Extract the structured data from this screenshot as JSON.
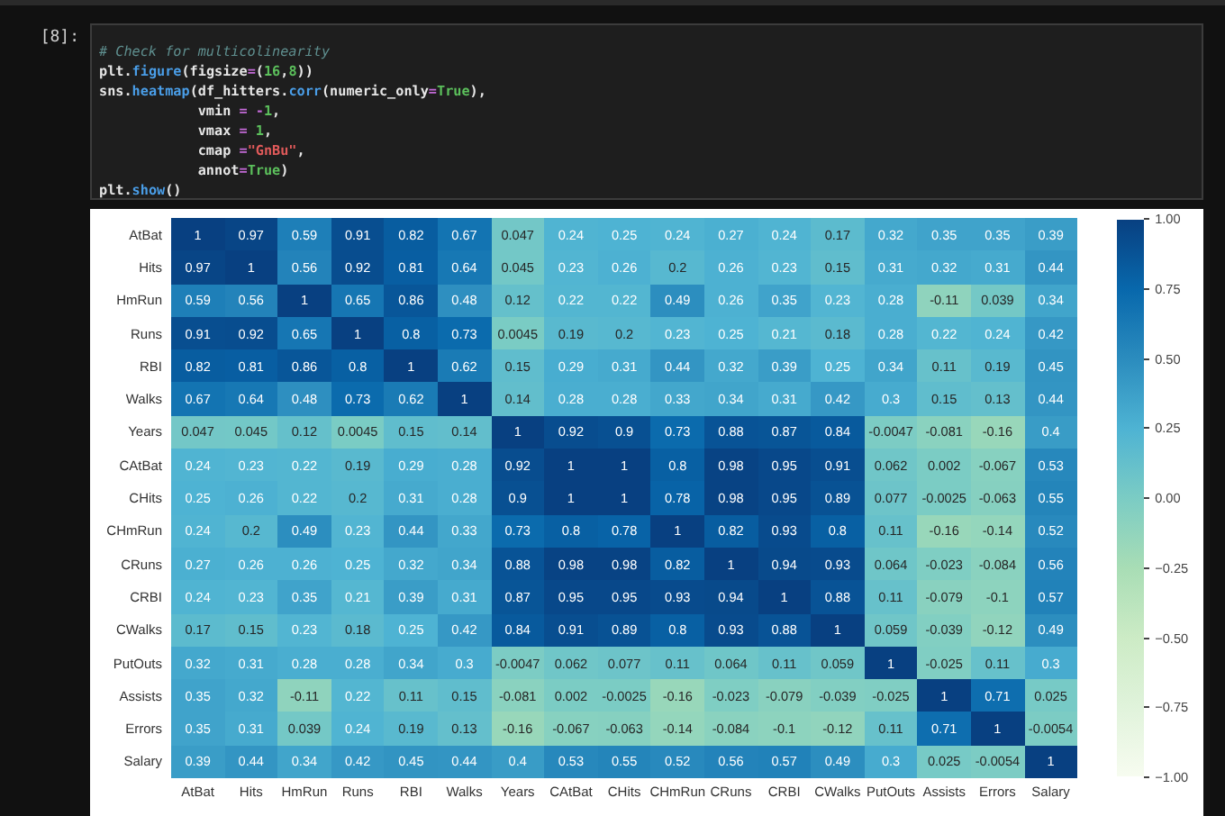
{
  "cell": {
    "prompt": "[8]:",
    "code_lines": [
      [
        {
          "kind": "comment",
          "text": "# Check for multicolinearity"
        }
      ],
      [
        {
          "kind": "plain",
          "text": "plt."
        },
        {
          "kind": "func",
          "text": "figure"
        },
        {
          "kind": "plain",
          "text": "(figsize"
        },
        {
          "kind": "op",
          "text": "="
        },
        {
          "kind": "plain",
          "text": "("
        },
        {
          "kind": "number",
          "text": "16"
        },
        {
          "kind": "plain",
          "text": ","
        },
        {
          "kind": "number",
          "text": "8"
        },
        {
          "kind": "plain",
          "text": "))"
        }
      ],
      [
        {
          "kind": "plain",
          "text": "sns."
        },
        {
          "kind": "func",
          "text": "heatmap"
        },
        {
          "kind": "plain",
          "text": "(df_hitters."
        },
        {
          "kind": "func",
          "text": "corr"
        },
        {
          "kind": "plain",
          "text": "(numeric_only"
        },
        {
          "kind": "op",
          "text": "="
        },
        {
          "kind": "keyword",
          "text": "True"
        },
        {
          "kind": "plain",
          "text": "),"
        }
      ],
      [
        {
          "kind": "plain",
          "text": "            vmin "
        },
        {
          "kind": "op",
          "text": "= -"
        },
        {
          "kind": "number",
          "text": "1"
        },
        {
          "kind": "plain",
          "text": ","
        }
      ],
      [
        {
          "kind": "plain",
          "text": "            vmax "
        },
        {
          "kind": "op",
          "text": "="
        },
        {
          "kind": "number",
          "text": " 1"
        },
        {
          "kind": "plain",
          "text": ","
        }
      ],
      [
        {
          "kind": "plain",
          "text": "            cmap "
        },
        {
          "kind": "op",
          "text": "="
        },
        {
          "kind": "string",
          "text": "\"GnBu\""
        },
        {
          "kind": "plain",
          "text": ","
        }
      ],
      [
        {
          "kind": "plain",
          "text": "            annot"
        },
        {
          "kind": "op",
          "text": "="
        },
        {
          "kind": "keyword",
          "text": "True"
        },
        {
          "kind": "plain",
          "text": ")"
        }
      ],
      [
        {
          "kind": "plain",
          "text": "plt."
        },
        {
          "kind": "func",
          "text": "show"
        },
        {
          "kind": "plain",
          "text": "()"
        }
      ]
    ]
  },
  "heatmap": {
    "column_labels": [
      "AtBat",
      "Hits",
      "HmRun",
      "Runs",
      "RBI",
      "Walks",
      "Years",
      "CAtBat",
      "CHits",
      "CHmRun",
      "CRuns",
      "CRBI",
      "CWalks",
      "PutOuts",
      "Assists",
      "Errors",
      "Salary"
    ],
    "rows": [
      {
        "label": "AtBat",
        "cells": [
          "1",
          "0.97",
          "0.59",
          "0.91",
          "0.82",
          "0.67",
          "0.047",
          "0.24",
          "0.25",
          "0.24",
          "0.27",
          "0.24",
          "0.17",
          "0.32",
          "0.35",
          "0.35",
          "0.39"
        ]
      },
      {
        "label": "Hits",
        "cells": [
          "0.97",
          "1",
          "0.56",
          "0.92",
          "0.81",
          "0.64",
          "0.045",
          "0.23",
          "0.26",
          "0.2",
          "0.26",
          "0.23",
          "0.15",
          "0.31",
          "0.32",
          "0.31",
          "0.44"
        ]
      },
      {
        "label": "HmRun",
        "cells": [
          "0.59",
          "0.56",
          "1",
          "0.65",
          "0.86",
          "0.48",
          "0.12",
          "0.22",
          "0.22",
          "0.49",
          "0.26",
          "0.35",
          "0.23",
          "0.28",
          "-0.11",
          "0.039",
          "0.34"
        ]
      },
      {
        "label": "Runs",
        "cells": [
          "0.91",
          "0.92",
          "0.65",
          "1",
          "0.8",
          "0.73",
          "0.0045",
          "0.19",
          "0.2",
          "0.23",
          "0.25",
          "0.21",
          "0.18",
          "0.28",
          "0.22",
          "0.24",
          "0.42"
        ]
      },
      {
        "label": "RBI",
        "cells": [
          "0.82",
          "0.81",
          "0.86",
          "0.8",
          "1",
          "0.62",
          "0.15",
          "0.29",
          "0.31",
          "0.44",
          "0.32",
          "0.39",
          "0.25",
          "0.34",
          "0.11",
          "0.19",
          "0.45"
        ]
      },
      {
        "label": "Walks",
        "cells": [
          "0.67",
          "0.64",
          "0.48",
          "0.73",
          "0.62",
          "1",
          "0.14",
          "0.28",
          "0.28",
          "0.33",
          "0.34",
          "0.31",
          "0.42",
          "0.3",
          "0.15",
          "0.13",
          "0.44"
        ]
      },
      {
        "label": "Years",
        "cells": [
          "0.047",
          "0.045",
          "0.12",
          "0.0045",
          "0.15",
          "0.14",
          "1",
          "0.92",
          "0.9",
          "0.73",
          "0.88",
          "0.87",
          "0.84",
          "-0.0047",
          "-0.081",
          "-0.16",
          "0.4"
        ]
      },
      {
        "label": "CAtBat",
        "cells": [
          "0.24",
          "0.23",
          "0.22",
          "0.19",
          "0.29",
          "0.28",
          "0.92",
          "1",
          "1",
          "0.8",
          "0.98",
          "0.95",
          "0.91",
          "0.062",
          "0.002",
          "-0.067",
          "0.53"
        ]
      },
      {
        "label": "CHits",
        "cells": [
          "0.25",
          "0.26",
          "0.22",
          "0.2",
          "0.31",
          "0.28",
          "0.9",
          "1",
          "1",
          "0.78",
          "0.98",
          "0.95",
          "0.89",
          "0.077",
          "-0.0025",
          "-0.063",
          "0.55"
        ]
      },
      {
        "label": "CHmRun",
        "cells": [
          "0.24",
          "0.2",
          "0.49",
          "0.23",
          "0.44",
          "0.33",
          "0.73",
          "0.8",
          "0.78",
          "1",
          "0.82",
          "0.93",
          "0.8",
          "0.11",
          "-0.16",
          "-0.14",
          "0.52"
        ]
      },
      {
        "label": "CRuns",
        "cells": [
          "0.27",
          "0.26",
          "0.26",
          "0.25",
          "0.32",
          "0.34",
          "0.88",
          "0.98",
          "0.98",
          "0.82",
          "1",
          "0.94",
          "0.93",
          "0.064",
          "-0.023",
          "-0.084",
          "0.56"
        ]
      },
      {
        "label": "CRBI",
        "cells": [
          "0.24",
          "0.23",
          "0.35",
          "0.21",
          "0.39",
          "0.31",
          "0.87",
          "0.95",
          "0.95",
          "0.93",
          "0.94",
          "1",
          "0.88",
          "0.11",
          "-0.079",
          "-0.1",
          "0.57"
        ]
      },
      {
        "label": "CWalks",
        "cells": [
          "0.17",
          "0.15",
          "0.23",
          "0.18",
          "0.25",
          "0.42",
          "0.84",
          "0.91",
          "0.89",
          "0.8",
          "0.93",
          "0.88",
          "1",
          "0.059",
          "-0.039",
          "-0.12",
          "0.49"
        ]
      },
      {
        "label": "PutOuts",
        "cells": [
          "0.32",
          "0.31",
          "0.28",
          "0.28",
          "0.34",
          "0.3",
          "-0.0047",
          "0.062",
          "0.077",
          "0.11",
          "0.064",
          "0.11",
          "0.059",
          "1",
          "-0.025",
          "0.11",
          "0.3"
        ]
      },
      {
        "label": "Assists",
        "cells": [
          "0.35",
          "0.32",
          "-0.11",
          "0.22",
          "0.11",
          "0.15",
          "-0.081",
          "0.002",
          "-0.0025",
          "-0.16",
          "-0.023",
          "-0.079",
          "-0.039",
          "-0.025",
          "1",
          "0.71",
          "0.025"
        ]
      },
      {
        "label": "Errors",
        "cells": [
          "0.35",
          "0.31",
          "0.039",
          "0.24",
          "0.19",
          "0.13",
          "-0.16",
          "-0.067",
          "-0.063",
          "-0.14",
          "-0.084",
          "-0.1",
          "-0.12",
          "0.11",
          "0.71",
          "1",
          "-0.0054"
        ]
      },
      {
        "label": "Salary",
        "cells": [
          "0.39",
          "0.44",
          "0.34",
          "0.42",
          "0.45",
          "0.44",
          "0.4",
          "0.53",
          "0.55",
          "0.52",
          "0.56",
          "0.57",
          "0.49",
          "0.3",
          "0.025",
          "-0.0054",
          "1"
        ]
      }
    ],
    "colorbar_ticks": [
      "1.00",
      "0.75",
      "0.50",
      "0.25",
      "0.00",
      "−0.25",
      "−0.50",
      "−0.75",
      "−1.00"
    ]
  }
}
